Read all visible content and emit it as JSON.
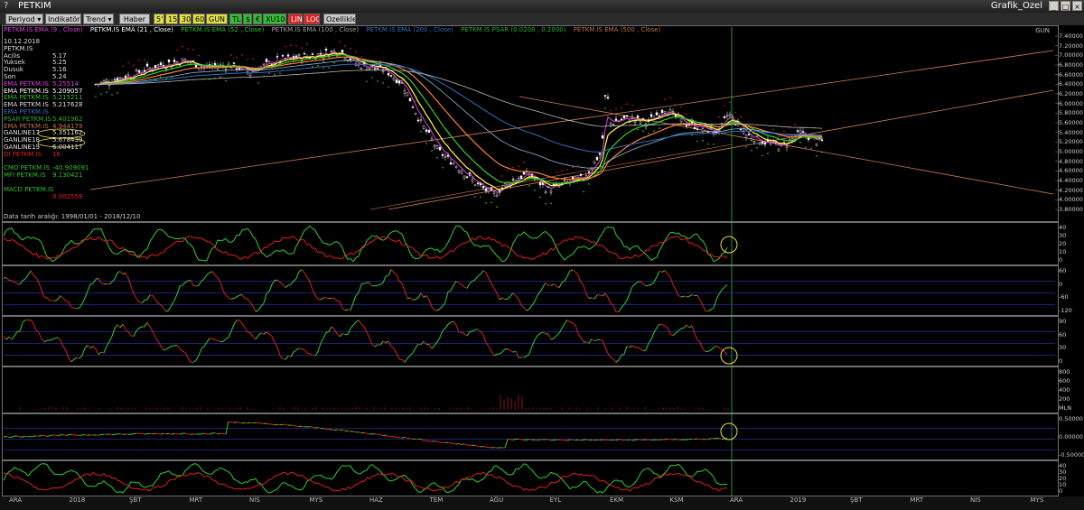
{
  "window": {
    "title": "PETKIM",
    "right_title": "Grafik_Ozel",
    "q": "?"
  },
  "toolbar": {
    "periyod": "Periyod ▾",
    "indikator": "Indikatör ▾",
    "trend": "Trend ▾",
    "haber": "Haber",
    "periods": [
      "5'",
      "15'",
      "30'",
      "60'",
      "GUN"
    ],
    "tl": "TL",
    "s": "$",
    "eur": "€",
    "xu100": "XU100",
    "lin": "LIN",
    "log": "LOG",
    "ozellikler": "Ozellikler"
  },
  "legend": [
    {
      "text": "PETKM.IS EMA (9 , Close)",
      "color": "#e040e0"
    },
    {
      "text": "PETKM.IS EMA (21 , Close)",
      "color": "#ffffff"
    },
    {
      "text": "PETKM.IS EMA (52 , Close)",
      "color": "#30c030"
    },
    {
      "text": "PETKM.IS EMA (100 , Close)",
      "color": "#a0a0a0"
    },
    {
      "text": "PETKM.IS EMA (200 , Close)",
      "color": "#3070c0"
    },
    {
      "text": "PETKM.IS PSAR (0.0200 , 0.2000)",
      "color": "#30b030"
    },
    {
      "text": "PETKM.IS EMA (500 , Close)",
      "color": "#c07050"
    }
  ],
  "gun": "GUN",
  "info": {
    "date": "10.12.2018",
    "symbol": "PETKM.IS",
    "rows": [
      {
        "label": "Acilis",
        "value": "5.17",
        "color": "#ddd"
      },
      {
        "label": "Yuksek",
        "value": "5.25",
        "color": "#ddd"
      },
      {
        "label": "Dusuk",
        "value": "5.16",
        "color": "#ddd"
      },
      {
        "label": "Son",
        "value": "5.24",
        "color": "#ddd"
      },
      {
        "label": "EMA PETKM.IS",
        "value": "5.25514",
        "color": "#e040e0"
      },
      {
        "label": "EMA PETKM.IS",
        "value": "5.209057",
        "color": "#ffffff"
      },
      {
        "label": "EMA PETKM.IS",
        "value": "5.215211",
        "color": "#30c030"
      },
      {
        "label": "EMA PETKM.IS",
        "value": "5.217628",
        "color": "#dddddd"
      },
      {
        "label": "EMA PETKM.IS",
        "value": "",
        "color": "#3070c0"
      },
      {
        "label": "PSAR PETKM.IS",
        "value": "5.401962",
        "color": "#30b030"
      },
      {
        "label": "EMA PETKM.IS",
        "value": "4.944179",
        "color": "#c07050"
      },
      {
        "label": "GANLINE17",
        "value": "5.351162",
        "color": "#ddd"
      },
      {
        "label": "GANLINE18",
        "value": "5.678439",
        "color": "#ddd"
      },
      {
        "label": "GANLINE19",
        "value": "6.004117",
        "color": "#ddd"
      },
      {
        "label": "DI PETKM.IS",
        "value": "16",
        "color": "#e02020"
      },
      {
        "label": "",
        "value": "",
        "color": "#ddd"
      },
      {
        "label": "CMO PETKM.IS",
        "value": "-40.909091",
        "color": "#30c030"
      },
      {
        "label": "MFI PETKM.IS",
        "value": "9.130421",
        "color": "#30c030"
      },
      {
        "label": "",
        "value": "",
        "color": "#ddd"
      },
      {
        "label": "MACD PETKM.IS",
        "value": "",
        "color": "#30c030"
      },
      {
        "label": "",
        "value": "0.002558",
        "color": "#e02020"
      },
      {
        "label": "",
        "value": "",
        "color": "#30c030"
      }
    ]
  },
  "date_range": "Data tarih aralığı: 1998/01/01 - 2018/12/10",
  "price_axis": [
    "7.40000",
    "7.20000",
    "7.00000",
    "6.80000",
    "6.60000",
    "6.40000",
    "6.20000",
    "6.00000",
    "5.80000",
    "5.60000",
    "5.40000",
    "5.20000",
    "5.00000",
    "4.80000",
    "4.60000",
    "4.40000",
    "4.20000",
    "4.00000",
    "3.80000"
  ],
  "panel_axes": [
    [
      "40",
      "30",
      "20",
      "10",
      "0"
    ],
    [
      "60",
      "0",
      "-60",
      "-120"
    ],
    [
      "90",
      "60",
      "30",
      "0"
    ],
    [
      "800",
      "600",
      "400",
      "200",
      "MLN"
    ],
    [
      "0.50000",
      "0.00000",
      "-0.50000"
    ],
    [
      "40",
      "30",
      "20",
      "10",
      "0"
    ]
  ],
  "months": [
    {
      "label": "ARA"
    },
    {
      "label": "2018"
    },
    {
      "label": "ŞBT"
    },
    {
      "label": "MRT"
    },
    {
      "label": "NİS"
    },
    {
      "label": "MYS"
    },
    {
      "label": "HAZ"
    },
    {
      "label": "TEM"
    },
    {
      "label": "AĞU"
    },
    {
      "label": "EYL"
    },
    {
      "label": "EKM"
    },
    {
      "label": "KSM"
    },
    {
      "label": "ARA"
    },
    {
      "label": "2019"
    },
    {
      "label": "ŞBT"
    },
    {
      "label": "MRT"
    },
    {
      "label": "NİS"
    },
    {
      "label": "MYS"
    }
  ],
  "colors": {
    "up": "#30d030",
    "down": "#e02020",
    "grid": "#2030a0"
  },
  "chart_data": {
    "type": "line",
    "price_range": [
      3.8,
      7.4
    ],
    "price_path": [
      [
        0,
        6.4
      ],
      [
        40,
        6.6
      ],
      [
        70,
        6.8
      ],
      [
        100,
        6.9
      ],
      [
        120,
        6.75
      ],
      [
        150,
        6.8
      ],
      [
        170,
        6.65
      ],
      [
        200,
        6.9
      ],
      [
        240,
        7.0
      ],
      [
        270,
        7.1
      ],
      [
        290,
        6.8
      ],
      [
        320,
        6.7
      ],
      [
        340,
        6.4
      ],
      [
        360,
        5.6
      ],
      [
        380,
        5.0
      ],
      [
        400,
        4.7
      ],
      [
        420,
        4.35
      ],
      [
        440,
        4.1
      ],
      [
        460,
        4.4
      ],
      [
        480,
        4.55
      ],
      [
        500,
        4.2
      ],
      [
        520,
        4.35
      ],
      [
        540,
        4.45
      ],
      [
        560,
        5.0
      ],
      [
        565,
        6.4
      ],
      [
        570,
        5.6
      ],
      [
        590,
        5.7
      ],
      [
        610,
        5.6
      ],
      [
        630,
        5.9
      ],
      [
        650,
        5.6
      ],
      [
        670,
        5.5
      ],
      [
        690,
        5.4
      ],
      [
        700,
        5.8
      ],
      [
        720,
        5.35
      ],
      [
        740,
        5.2
      ],
      [
        760,
        5.1
      ],
      [
        780,
        5.4
      ],
      [
        800,
        5.2
      ],
      [
        810,
        5.24
      ]
    ]
  }
}
